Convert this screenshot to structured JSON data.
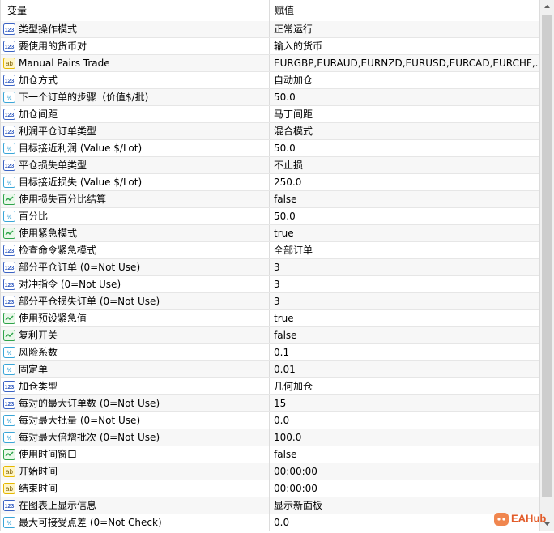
{
  "header": {
    "variable": "变量",
    "value": "赋值"
  },
  "rows": [
    {
      "icon": "int",
      "name": "类型操作模式",
      "value": "正常运行"
    },
    {
      "icon": "int",
      "name": "要使用的货币对",
      "value": "输入的货币"
    },
    {
      "icon": "str",
      "name": "Manual Pairs Trade",
      "value": "EURGBP,EURAUD,EURNZD,EURUSD,EURCAD,EURCHF,..."
    },
    {
      "icon": "int",
      "name": "加仓方式",
      "value": "自动加仓"
    },
    {
      "icon": "dbl",
      "name": "下一个订单的步骤（价值$/批)",
      "value": "50.0"
    },
    {
      "icon": "int",
      "name": "加仓间距",
      "value": "马丁间距"
    },
    {
      "icon": "int",
      "name": "利润平仓订单类型",
      "value": "混合模式"
    },
    {
      "icon": "dbl",
      "name": "目标接近利润 (Value $/Lot)",
      "value": "50.0"
    },
    {
      "icon": "int",
      "name": "平仓损失单类型",
      "value": "不止损"
    },
    {
      "icon": "dbl",
      "name": "目标接近损失 (Value $/Lot)",
      "value": "250.0"
    },
    {
      "icon": "bool",
      "name": "使用损失百分比结算",
      "value": "false"
    },
    {
      "icon": "dbl",
      "name": "百分比",
      "value": "50.0"
    },
    {
      "icon": "bool",
      "name": "使用紧急模式",
      "value": "true"
    },
    {
      "icon": "int",
      "name": "检查命令紧急模式",
      "value": "全部订单"
    },
    {
      "icon": "int",
      "name": "部分平仓订单 (0=Not Use)",
      "value": "3"
    },
    {
      "icon": "int",
      "name": "对冲指令 (0=Not Use)",
      "value": "3"
    },
    {
      "icon": "int",
      "name": "部分平仓损失订单 (0=Not Use)",
      "value": "3"
    },
    {
      "icon": "bool",
      "name": "使用预设紧急值",
      "value": "true"
    },
    {
      "icon": "bool",
      "name": "复利开关",
      "value": "false"
    },
    {
      "icon": "dbl",
      "name": "风险系数",
      "value": "0.1"
    },
    {
      "icon": "dbl",
      "name": "固定单",
      "value": "0.01"
    },
    {
      "icon": "int",
      "name": "加仓类型",
      "value": "几何加仓"
    },
    {
      "icon": "int",
      "name": "每对的最大订单数 (0=Not Use)",
      "value": "15"
    },
    {
      "icon": "dbl",
      "name": "每对最大批量 (0=Not Use)",
      "value": "0.0"
    },
    {
      "icon": "dbl",
      "name": "每对最大倍增批次 (0=Not Use)",
      "value": "100.0"
    },
    {
      "icon": "bool",
      "name": "使用时间窗口",
      "value": "false"
    },
    {
      "icon": "str",
      "name": "开始时间",
      "value": "00:00:00"
    },
    {
      "icon": "str",
      "name": "结束时间",
      "value": "00:00:00"
    },
    {
      "icon": "int",
      "name": "在图表上显示信息",
      "value": "显示新面板"
    },
    {
      "icon": "dbl",
      "name": "最大可接受点差 (0=Not Check)",
      "value": "0.0"
    }
  ],
  "watermark": "EAHub",
  "colors": {
    "int_icon": "#3b63c4",
    "dbl_icon": "#3aa6d8",
    "str_icon": "#e6b800",
    "bool_icon": "#2ea34a"
  }
}
